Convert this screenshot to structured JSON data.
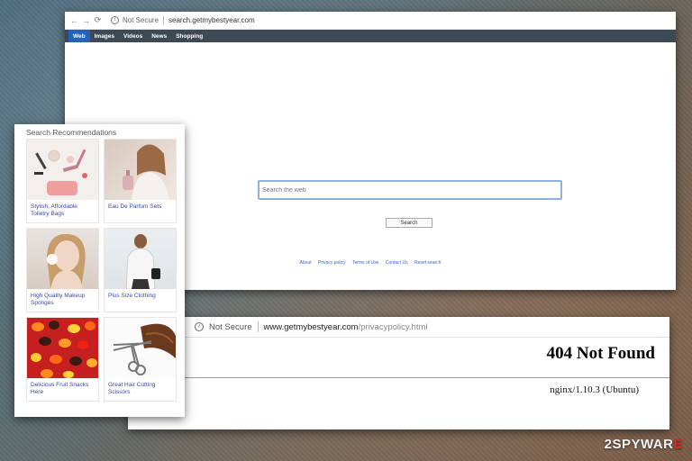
{
  "browser": {
    "nav_back": "←",
    "nav_forward": "→",
    "nav_reload": "⟳",
    "security_label": "Not Secure",
    "url": "search.getmybestyear.com",
    "tabs": [
      {
        "label": "Web",
        "active": true
      },
      {
        "label": "Images"
      },
      {
        "label": "Videos"
      },
      {
        "label": "News"
      },
      {
        "label": "Shopping"
      }
    ],
    "search_placeholder": "Search the web",
    "search_button": "Search",
    "footer_links": [
      "About",
      "Privacy policy",
      "Terms of Use",
      "Contact Us",
      "Reset search"
    ]
  },
  "error_window": {
    "security_label": "Not Secure",
    "url_host": "www.getmybestyear.com",
    "url_path": "/privacypolicy.html",
    "title": "404 Not Found",
    "server": "nginx/1.10.3 (Ubuntu)"
  },
  "recommendations": {
    "title": "Search Recommendations",
    "items": [
      {
        "label": "Stylish, Affordable Toiletry Bags"
      },
      {
        "label": "Eau De Parfum Sets"
      },
      {
        "label": "High Quality Makeup Sponges"
      },
      {
        "label": "Plus Size Clothing"
      },
      {
        "label": "Delicious Fruit Snacks Here"
      },
      {
        "label": "Great Hair Cutting Scissors"
      }
    ]
  },
  "watermark": {
    "prefix": "2SPYWAR",
    "suffix": "E"
  },
  "colors": {
    "tab_bar": "#3d4a55",
    "active_tab": "#2563b8",
    "link": "#3b64b6",
    "watermark_accent": "#d42a2a"
  }
}
